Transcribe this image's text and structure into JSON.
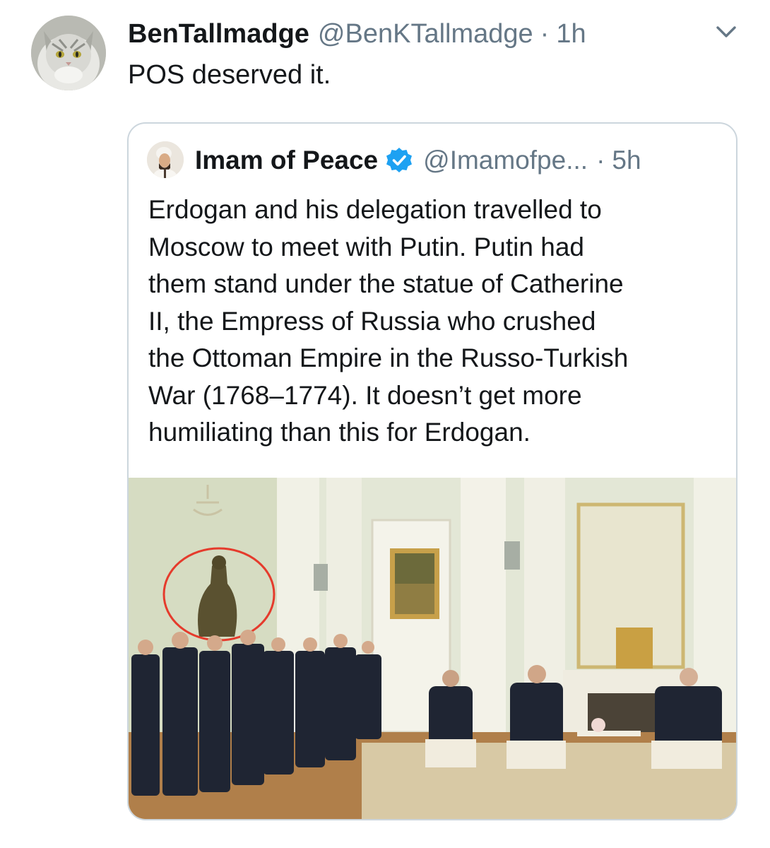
{
  "tweet": {
    "display_name": "BenTallmadge",
    "handle": "@BenKTallmadge",
    "separator": "·",
    "time": "1h",
    "text": "POS deserved it.",
    "avatar_icon": "cat-avatar-icon",
    "menu_icon": "chevron-down-icon"
  },
  "quoted_tweet": {
    "display_name": "Imam of Peace",
    "verified_icon": "verified-badge-icon",
    "handle": "@Imamofpe...",
    "separator": "·",
    "time": "5h",
    "text_lines": [
      "Erdogan and his delegation travelled to",
      "Moscow to meet with Putin. Putin had",
      "them stand under the statue of Catherine",
      "II, the Empress of Russia who crushed",
      "the Ottoman Empire in the Russo-Turkish",
      "War (1768–1774). It doesn’t get more",
      "humiliating than this for Erdogan."
    ],
    "photo": "kremlin-meeting-photo"
  },
  "colors": {
    "text": "#14171a",
    "secondary": "#657786",
    "border": "#ccd6dd",
    "verified": "#1da1f2",
    "highlight_circle": "#e53b2c"
  }
}
